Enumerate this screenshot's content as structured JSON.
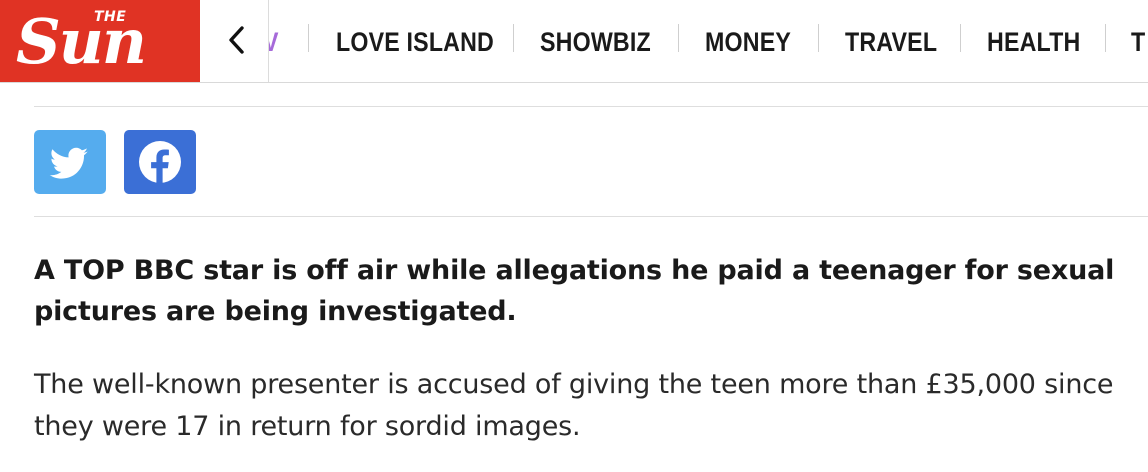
{
  "header": {
    "logo": {
      "small": "THE",
      "main": "Sun"
    },
    "nav": [
      {
        "label": "V"
      },
      {
        "label": "LOVE ISLAND"
      },
      {
        "label": "SHOWBIZ"
      },
      {
        "label": "MONEY"
      },
      {
        "label": "TRAVEL"
      },
      {
        "label": "HEALTH"
      },
      {
        "label": "T"
      }
    ]
  },
  "share": {
    "twitter_icon": "twitter-icon",
    "facebook_icon": "facebook-icon"
  },
  "article": {
    "lead": "A TOP BBC star is off air while allegations he paid a teenager for sexual pictures are being investigated.",
    "paragraph": "The well-known presenter is accused of giving the teen more than £35,000 since they were 17 in return for sordid images."
  },
  "colors": {
    "brand_red": "#e03324",
    "twitter_blue": "#55acee",
    "facebook_blue": "#3b6fd6",
    "partial_nav_purple": "#a66ad9"
  }
}
